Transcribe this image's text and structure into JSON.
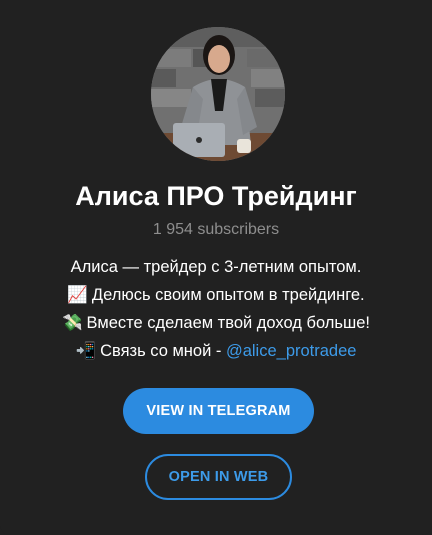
{
  "channel": {
    "title": "Алиса ПРО Трейдинг",
    "subscribers": "1 954 subscribers"
  },
  "description": {
    "line1": "Алиса — трейдер с 3-летним опытом.",
    "line2_emoji": "📈",
    "line2_text": "Делюсь своим опытом в трейдинге.",
    "line3_emoji": "💸",
    "line3_text": "Вместе сделаем твой доход больше!",
    "line4_emoji": "📲",
    "line4_text": "Связь со мной - ",
    "line4_link": "@alice_protradee"
  },
  "buttons": {
    "view_in_telegram": "VIEW IN TELEGRAM",
    "open_in_web": "OPEN IN WEB"
  },
  "colors": {
    "background": "#212121",
    "accent": "#2c8be0",
    "link": "#3d9be9",
    "muted_text": "#8e8e8e"
  }
}
